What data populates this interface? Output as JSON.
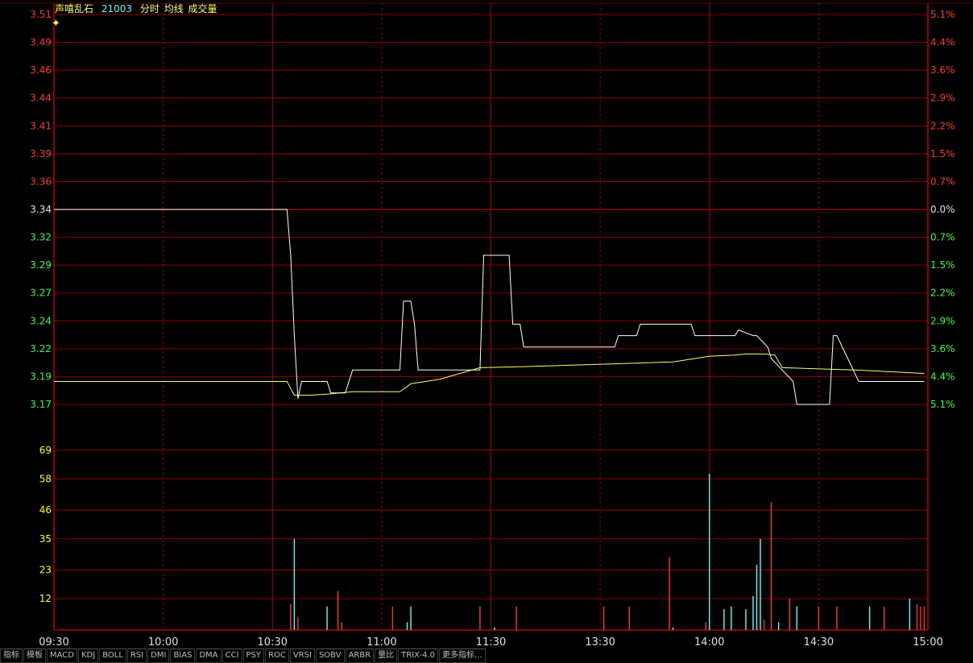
{
  "header": {
    "stock_name": "声嘻乱石",
    "stock_code": "21003",
    "labels": [
      "分时",
      "均线",
      "成交量"
    ]
  },
  "colors": {
    "grid": "#8b0000",
    "up": "#ff3232",
    "down": "#32ff32",
    "neutral": "#e0e0e0",
    "price_line": "#ffffff",
    "avg_line": "#ffff66",
    "vol_up": "#ff3232",
    "vol_down": "#54ffff",
    "time_label": "#e0e0e0",
    "vol_label": "#ffff00"
  },
  "tabs": [
    "指标",
    "模板",
    "MACD",
    "KDJ",
    "BOLL",
    "RSI",
    "DMI",
    "BIAS",
    "DMA",
    "CCI",
    "PSY",
    "ROC",
    "VRSI",
    "SOBV",
    "ARBR",
    "量比",
    "TRIX-4.0",
    "更多指标..."
  ],
  "chart_data": [
    {
      "type": "line",
      "title": "分时",
      "prev_close": 3.34,
      "price_ticks": [
        "3.51",
        "3.49",
        "3.46",
        "3.44",
        "3.41",
        "3.39",
        "3.36",
        "3.34",
        "3.32",
        "3.29",
        "3.27",
        "3.24",
        "3.22",
        "3.19",
        "3.17"
      ],
      "pct_ticks": [
        "5.1%",
        "4.4%",
        "3.6%",
        "2.9%",
        "2.2%",
        "1.5%",
        "0.7%",
        "0.0%",
        "0.7%",
        "1.5%",
        "2.2%",
        "2.9%",
        "3.6%",
        "4.4%",
        "5.1%"
      ],
      "ylim": [
        3.17,
        3.51
      ],
      "x_ticks": [
        "09:30",
        "10:00",
        "10:30",
        "11:00",
        "11:30",
        "13:30",
        "14:00",
        "14:30",
        "15:00"
      ],
      "x_minutes": [
        0,
        240
      ],
      "series": [
        {
          "name": "价格",
          "x": [
            0,
            64,
            65,
            66,
            67,
            68,
            70,
            75,
            76,
            80,
            81,
            82,
            95,
            96,
            98,
            99,
            100,
            102,
            103,
            106,
            117,
            118,
            125,
            126,
            128,
            129,
            154,
            155,
            160,
            161,
            162,
            170,
            175,
            176,
            187,
            188,
            192,
            193,
            196,
            197,
            200,
            203,
            204,
            205,
            213,
            214,
            215,
            221,
            222,
            239
          ],
          "y": [
            3.34,
            3.34,
            3.3,
            3.23,
            3.175,
            3.19,
            3.19,
            3.19,
            3.18,
            3.18,
            3.19,
            3.2,
            3.2,
            3.26,
            3.26,
            3.24,
            3.2,
            3.2,
            3.2,
            3.2,
            3.2,
            3.3,
            3.3,
            3.24,
            3.24,
            3.22,
            3.22,
            3.23,
            3.23,
            3.24,
            3.24,
            3.24,
            3.24,
            3.23,
            3.23,
            3.235,
            3.23,
            3.23,
            3.22,
            3.21,
            3.2,
            3.19,
            3.17,
            3.17,
            3.17,
            3.23,
            3.23,
            3.19,
            3.19,
            3.19
          ]
        },
        {
          "name": "均价",
          "x": [
            0,
            64,
            66,
            70,
            75,
            82,
            95,
            98,
            106,
            117,
            130,
            160,
            170,
            180,
            187,
            190,
            195,
            198,
            200,
            220,
            239
          ],
          "y": [
            3.19,
            3.19,
            3.178,
            3.178,
            3.179,
            3.181,
            3.181,
            3.188,
            3.192,
            3.202,
            3.203,
            3.206,
            3.207,
            3.212,
            3.213,
            3.214,
            3.214,
            3.213,
            3.202,
            3.2,
            3.197
          ]
        }
      ]
    },
    {
      "type": "bar",
      "title": "成交量",
      "vol_ticks": [
        "69",
        "58",
        "46",
        "35",
        "23",
        "12"
      ],
      "ylim": [
        0,
        81
      ],
      "x": [
        65,
        66,
        67,
        75,
        78,
        79,
        93,
        97,
        98,
        117,
        121,
        127,
        151,
        158,
        169,
        170,
        179,
        180,
        184,
        186,
        190,
        192,
        193,
        194,
        195,
        197,
        199,
        202,
        204,
        210,
        215,
        224,
        228,
        235,
        237,
        238,
        239
      ],
      "values": [
        10,
        35,
        5,
        9,
        15,
        3,
        9,
        3,
        9,
        9,
        1,
        9,
        9,
        9,
        28,
        1,
        3,
        60,
        8,
        9,
        8,
        13,
        25,
        35,
        4,
        49,
        3,
        12,
        9,
        9,
        9,
        9,
        9,
        12,
        10,
        9,
        9
      ],
      "up": [
        true,
        false,
        true,
        false,
        true,
        true,
        true,
        false,
        false,
        true,
        false,
        true,
        true,
        true,
        true,
        false,
        true,
        false,
        false,
        false,
        false,
        false,
        false,
        false,
        true,
        true,
        false,
        true,
        false,
        true,
        true,
        false,
        true,
        false,
        true,
        true,
        true
      ]
    }
  ]
}
